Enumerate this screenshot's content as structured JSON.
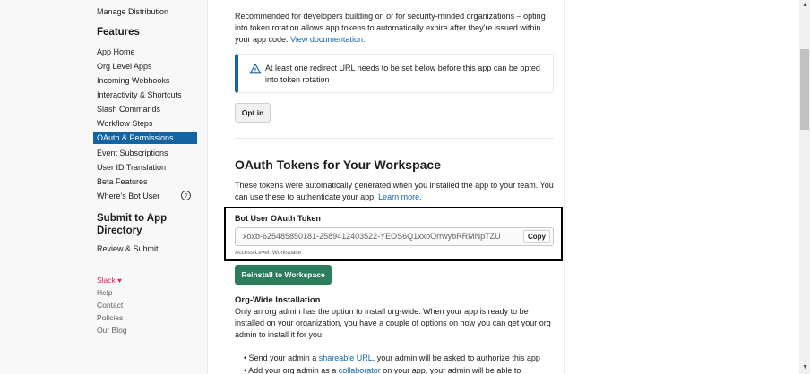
{
  "sidebar": {
    "top_item": "Manage Distribution",
    "features_heading": "Features",
    "features": [
      "App Home",
      "Org Level Apps",
      "Incoming Webhooks",
      "Interactivity & Shortcuts",
      "Slash Commands",
      "Workflow Steps",
      "OAuth & Permissions",
      "Event Subscriptions",
      "User ID Translation",
      "Beta Features",
      "Where's Bot User"
    ],
    "help_icon_glyph": "?",
    "submit_heading": "Submit to App Directory",
    "review_submit": "Review & Submit",
    "footer": {
      "slack": "Slack",
      "help": "Help",
      "contact": "Contact",
      "policies": "Policies",
      "blog": "Our Blog"
    }
  },
  "rotation": {
    "intro": "Recommended for developers building on or for security-minded organizations – opting into token rotation allows app tokens to automatically expire after they're issued within your app code.",
    "doc_link": "View documentation.",
    "callout": "At least one redirect URL needs to be set below before this app can be opted into token rotation",
    "opt_in_label": "Opt in"
  },
  "tokens": {
    "heading": "OAuth Tokens for Your Workspace",
    "description": "These tokens were automatically generated when you installed the app to your team. You can use these to authenticate your app.",
    "learn_more": "Learn more.",
    "bot_label": "Bot User OAuth Token",
    "bot_token": "xoxb-625485850181-2589412403522-YEOS6Q1xxoOrrwybRRMNpTZU",
    "copy_label": "Copy",
    "access_level": "Access Level: Workspace",
    "reinstall_label": "Reinstall to Workspace"
  },
  "org_install": {
    "heading": "Org-Wide Installation",
    "description": "Only an org admin has the option to install org-wide. When your app is ready to be installed on your organization, you have a couple of options on how you can get your org admin to install it for you:",
    "bullet1_pre": "Send your admin a ",
    "bullet1_link": "shareable URL",
    "bullet1_post": ", your admin will be asked to authorize this app",
    "bullet2_pre": "Add your org admin as a ",
    "bullet2_link": "collaborator",
    "bullet2_post": " on your app, your admin will be able to"
  },
  "colors": {
    "accent": "#1264a3",
    "green": "#2b7d5c",
    "slack_red": "#e01e5a"
  }
}
